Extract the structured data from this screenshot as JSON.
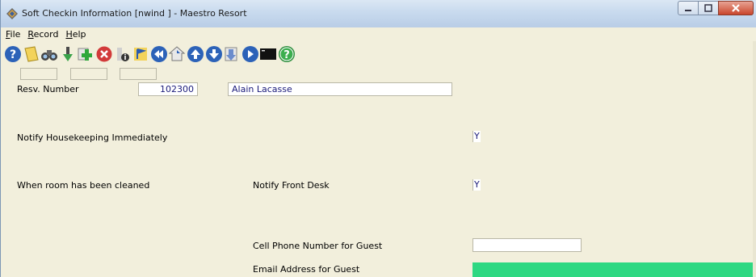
{
  "window": {
    "title": "Soft Checkin Information [nwind  ] - Maestro Resort",
    "minimize_icon": "minimize-icon",
    "maximize_icon": "maximize-icon",
    "close_icon": "close-icon"
  },
  "menu": {
    "file_u": "F",
    "file_rest": "ile",
    "record_u": "R",
    "record_rest": "ecord",
    "help_u": "H",
    "help_rest": "elp"
  },
  "toolbar": {
    "buttons": [
      "help-icon",
      "note-icon",
      "binoculars-icon",
      "down-arrow-icon",
      "add-icon",
      "delete-icon",
      "info-icon",
      "flag-icon",
      "first-record-icon",
      "home-icon",
      "previous-record-icon",
      "next-record-icon",
      "last-record-icon",
      "skip-icon",
      "console-icon",
      "help-circle-icon"
    ]
  },
  "form": {
    "resv_label": "Resv. Number",
    "resv_number": "102300",
    "guest_name": "Alain Lacasse",
    "notify_hk_label": "Notify Housekeeping Immediately",
    "notify_hk_value": "Y",
    "room_cleaned_label": "When room has been cleaned",
    "notify_fd_label": "Notify Front Desk",
    "notify_fd_value": "Y",
    "cell_label": "Cell Phone Number for Guest",
    "cell_value": "",
    "email_label": "Email Address for Guest"
  },
  "colors": {
    "form_bg": "#f2efdc",
    "email_highlight": "#2ed882",
    "titlebar": "#c8daee"
  }
}
